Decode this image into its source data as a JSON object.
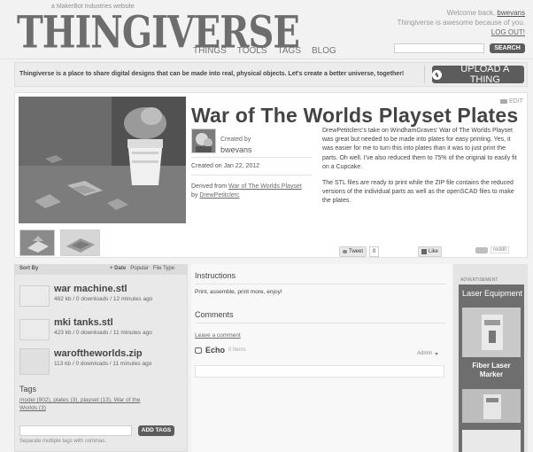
{
  "brand": {
    "tagline": "a MakerBot Industries website",
    "logo": "THINGIVERSE"
  },
  "nav": [
    "THINGS",
    "TOOLS",
    "TAGS",
    "BLOG"
  ],
  "user": {
    "welcome_prefix": "Welcome back,",
    "username": "bwevans",
    "awesome": "Thingiverse is awesome because of you.",
    "logout": "LOG OUT!"
  },
  "search": {
    "button": "SEARCH",
    "placeholder": ""
  },
  "banner": {
    "text": "Thingiverse is a place to share digital designs that can be made into real, physical objects. Let's create a better universe, together!",
    "upload": "UPLOAD A THING"
  },
  "thing": {
    "title": "War of The Worlds Playset Plates",
    "edit": "EDIT",
    "created_by": "Created by",
    "creator": "bwevans",
    "created_on": "Created on Jan 22, 2012",
    "derived_from": "Derived from",
    "derived_link": "War of The Worlds Playset",
    "by": "by",
    "derived_author": "DrewPetitclerc",
    "desc1": "DrewPetitclerc's take on WindhamGraves' War of The Worlds Playset was great but needed to be made into plates for easy printing. Yes, it was easier for me to turn this into plates than it was to just print the parts. Oh well. I've also reduced them to 75% of the original to easily fit on a Cupcake.",
    "desc2": "The STL files are ready to print while the ZIP file contains the reduced versions of the individual parts as well as the openSCAD files to make the plates.",
    "tweet": "Tweet",
    "tweet_count": "0",
    "like": "Like",
    "reddit": "reddit"
  },
  "files": {
    "sort_by": "Sort By",
    "sorts": [
      "+ Date",
      "Popular",
      "File Type"
    ],
    "items": [
      {
        "name": "war machine.stl",
        "meta": "482 kb / 0 downloads / 12 minutes ago"
      },
      {
        "name": "mki tanks.stl",
        "meta": "423 kb / 0 downloads / 11 minutes ago"
      },
      {
        "name": "waroftheworlds.zip",
        "meta": "113 kb / 0 downloads / 11 minutes ago"
      }
    ]
  },
  "tags": {
    "heading": "Tags",
    "line1": "model (902), plates (3), playset (13), War of the",
    "line2": "Worlds (3)",
    "add": "ADD TAGS",
    "hint": "Separate multiple tags with commas."
  },
  "instructions": {
    "heading": "Instructions",
    "text": "Print, assemble, print more, enjoy!"
  },
  "comments": {
    "heading": "Comments",
    "leave": "Leave a comment",
    "echo": "Echo",
    "items": "0 Items",
    "admin": "Admin"
  },
  "ad": {
    "label": "ADVERTISEMENT",
    "title": "Laser Equipment",
    "product": "Fiber Laser Marker"
  },
  "colors": {
    "button": "#5c5c5c",
    "link": "#6a6a6a",
    "header_bg": "#f2f2f2"
  },
  "icons": [
    "upload-icon",
    "edit-icon",
    "echo-icon",
    "twitter-icon",
    "facebook-icon",
    "share-icon"
  ]
}
